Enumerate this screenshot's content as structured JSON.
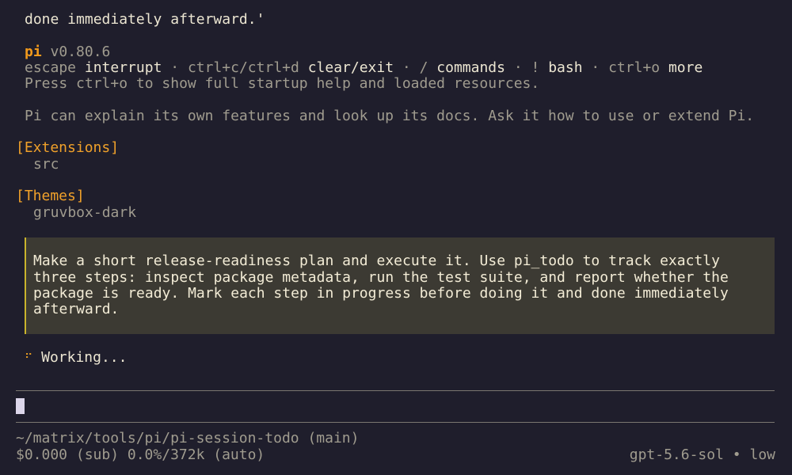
{
  "scrollback": {
    "top_line": "done immediately afterward.'"
  },
  "header": {
    "app_name": "pi",
    "version": "v0.80.6",
    "shortcuts": [
      {
        "key": "escape",
        "action": "interrupt"
      },
      {
        "key": "ctrl+c/ctrl+d",
        "action": "clear/exit"
      },
      {
        "key": "/",
        "action": "commands"
      },
      {
        "key": "!",
        "action": "bash"
      },
      {
        "key": "ctrl+o",
        "action": "more"
      }
    ],
    "separator": "·",
    "startup_hint": "Press ctrl+o to show full startup help and loaded resources.",
    "about": "Pi can explain its own features and look up its docs. Ask it how to use or extend Pi."
  },
  "sections": [
    {
      "title": "[Extensions]",
      "items": [
        "src"
      ]
    },
    {
      "title": "[Themes]",
      "items": [
        "gruvbox-dark"
      ]
    }
  ],
  "user_prompt": {
    "lines": [
      "Make a short release-readiness plan and execute it. Use pi_todo to track exactly",
      "three steps: inspect package metadata, run the test suite, and report whether the",
      "package is ready. Mark each step in progress before doing it and done immediately",
      "afterward."
    ]
  },
  "status": {
    "spinner_icon": "⠋",
    "text": "Working..."
  },
  "input": {
    "value": ""
  },
  "footer": {
    "cwd": "~/matrix/tools/pi/pi-session-todo (main)",
    "usage": "$0.000 (sub) 0.0%/372k (auto)",
    "model": "gpt-5.6-sol",
    "separator": "•",
    "thinking_level": "low"
  },
  "colors": {
    "background": "#1f1e2c",
    "accent_orange": "#f0a12a",
    "prompt_background": "#3c3a33",
    "prompt_border": "#c9b42c",
    "text": "#c9c3b2"
  }
}
